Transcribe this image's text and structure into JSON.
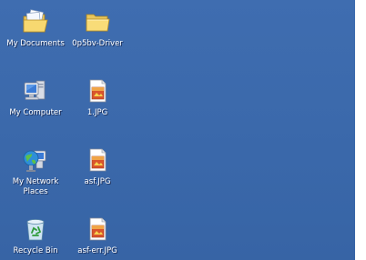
{
  "desktop": {
    "icons": [
      {
        "label": "My Documents",
        "icon": "my-documents-icon"
      },
      {
        "label": "0p5bv-Driver",
        "icon": "folder-icon"
      },
      {
        "label": "My Computer",
        "icon": "my-computer-icon"
      },
      {
        "label": "1.JPG",
        "icon": "jpg-file-icon"
      },
      {
        "label": "My Network Places",
        "icon": "network-places-icon"
      },
      {
        "label": "asf.JPG",
        "icon": "jpg-file-icon"
      },
      {
        "label": "Recycle Bin",
        "icon": "recycle-bin-icon"
      },
      {
        "label": "asf-err.JPG",
        "icon": "jpg-file-icon"
      }
    ]
  },
  "colors": {
    "desktop_background": "#3a6ea5",
    "label_text": "#ffffff"
  }
}
